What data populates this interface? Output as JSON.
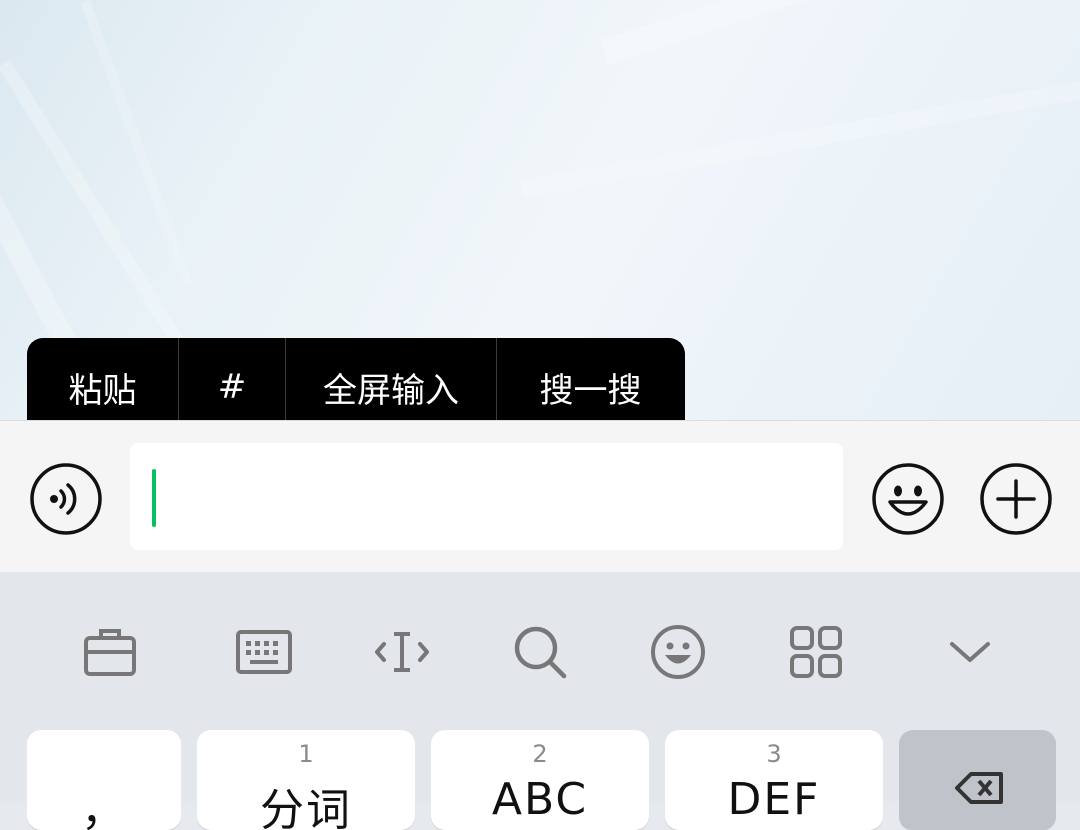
{
  "context_menu": {
    "items": [
      {
        "label": "粘贴"
      },
      {
        "label": "#"
      },
      {
        "label": "全屏输入"
      },
      {
        "label": "搜一搜"
      }
    ]
  },
  "input_bar": {
    "text_value": "",
    "voice_icon": "voice-icon",
    "emoji_icon": "emoji-icon",
    "plus_icon": "plus-icon"
  },
  "keyboard": {
    "toolbar": [
      "clipboard-icon",
      "keyboard-icon",
      "cursor-icon",
      "search-icon",
      "emoji-icon",
      "apps-icon",
      "chevron-down-icon"
    ],
    "keys": [
      {
        "label": "，",
        "num": ""
      },
      {
        "label": "分词",
        "num": "1"
      },
      {
        "label": "ABC",
        "num": "2"
      },
      {
        "label": "DEF",
        "num": "3"
      },
      {
        "label": "",
        "num": ""
      }
    ]
  },
  "colors": {
    "caret": "#07c160",
    "menu_bg": "#000000"
  }
}
